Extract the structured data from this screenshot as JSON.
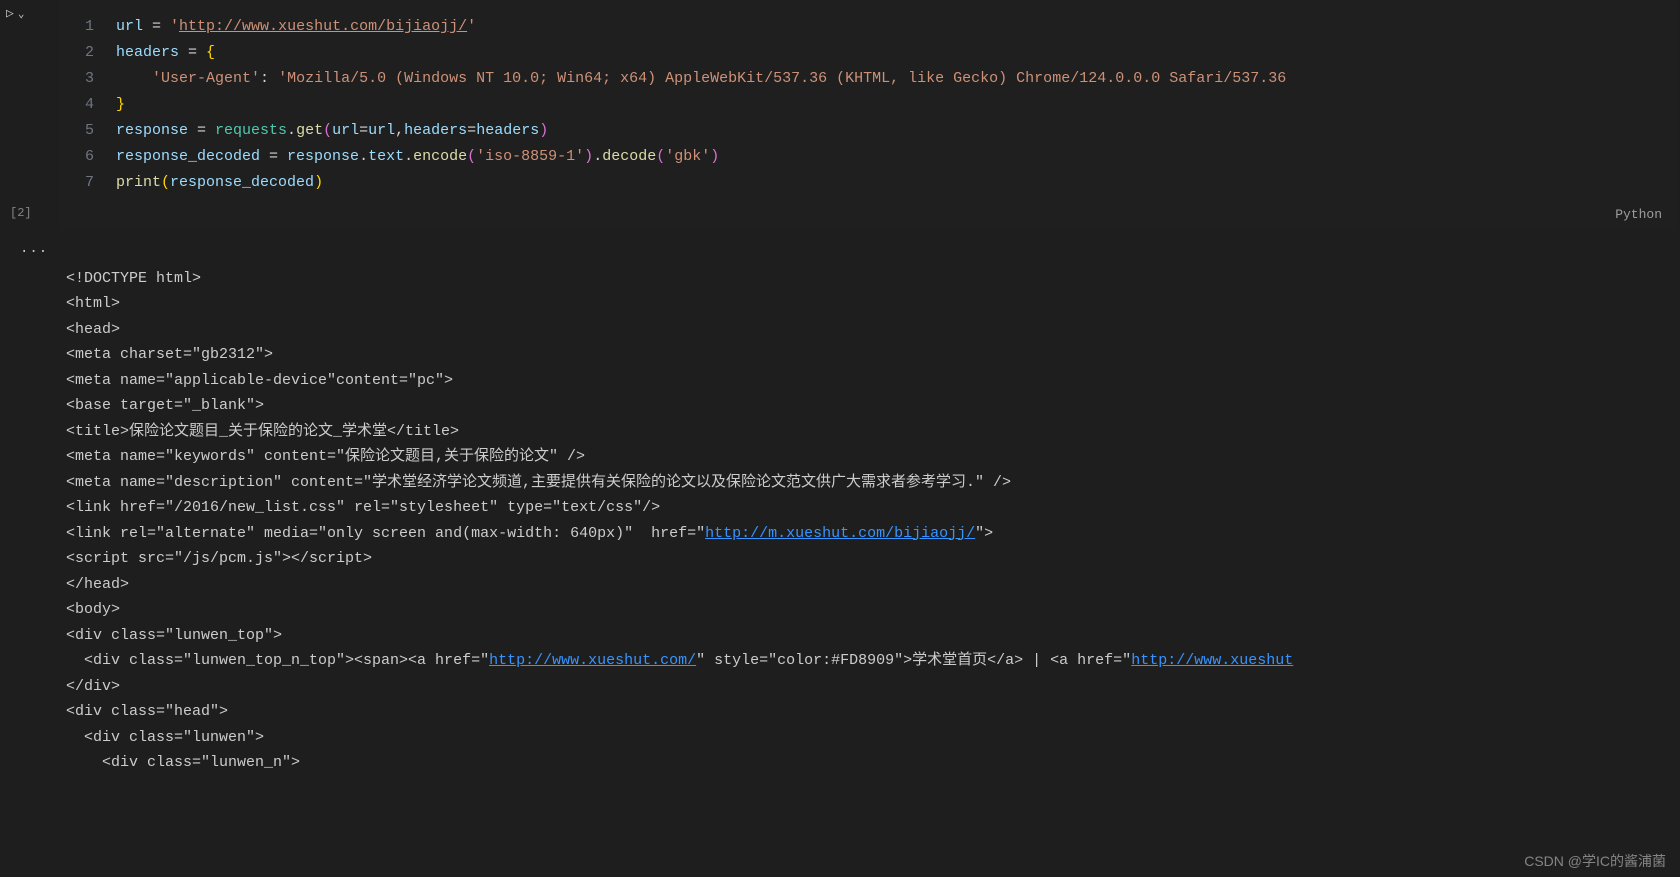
{
  "cell": {
    "execution_count": "[2]",
    "language": "Python",
    "lines": {
      "l1": {
        "num": "1",
        "var": "url",
        "eq": " = ",
        "q1": "'",
        "url": "http://www.xueshut.com/bijiaojj/",
        "q2": "'"
      },
      "l2": {
        "num": "2",
        "var": "headers",
        "eq": " = ",
        "brace": "{"
      },
      "l3": {
        "num": "3",
        "indent": "    ",
        "key": "'User-Agent'",
        "colon": ": ",
        "val": "'Mozilla/5.0 (Windows NT 10.0; Win64; x64) AppleWebKit/537.36 (KHTML, like Gecko) Chrome/124.0.0.0 Safari/537.36"
      },
      "l4": {
        "num": "4",
        "brace": "}"
      },
      "l5": {
        "num": "5",
        "var": "response",
        "eq": " = ",
        "mod": "requests",
        "dot": ".",
        "fn": "get",
        "lp": "(",
        "a1": "url",
        "eq2": "=",
        "a2": "url",
        "comma": ",",
        "a3": "headers",
        "eq3": "=",
        "a4": "headers",
        "rp": ")"
      },
      "l6": {
        "num": "6",
        "var": "response_decoded",
        "eq": " = ",
        "a1": "response",
        "d1": ".",
        "a2": "text",
        "d2": ".",
        "fn1": "encode",
        "lp1": "(",
        "s1": "'iso-8859-1'",
        "rp1": ")",
        "d3": ".",
        "fn2": "decode",
        "lp2": "(",
        "s2": "'gbk'",
        "rp2": ")"
      },
      "l7": {
        "num": "7",
        "fn": "print",
        "lp": "(",
        "arg": "response_decoded",
        "rp": ")"
      }
    }
  },
  "output": {
    "l1": "<!DOCTYPE html>",
    "l2": "<html>",
    "l3": "<head>",
    "l4": "<meta charset=\"gb2312\">",
    "l5": "<meta name=\"applicable-device\"content=\"pc\">",
    "l6": "<base target=\"_blank\">",
    "l7": "<title>保险论文题目_关于保险的论文_学术堂</title>",
    "l8": "<meta name=\"keywords\" content=\"保险论文题目,关于保险的论文\" />",
    "l9": "<meta name=\"description\" content=\"学术堂经济学论文频道,主要提供有关保险的论文以及保险论文范文供广大需求者参考学习.\" />",
    "l10": "<link href=\"/2016/new_list.css\" rel=\"stylesheet\" type=\"text/css\"/>",
    "l11a": "<link rel=\"alternate\" media=\"only screen and(max-width: 640px)\"  href=\"",
    "l11link": "http://m.xueshut.com/bijiaojj/",
    "l11b": "\">",
    "l12": "<script src=\"/js/pcm.js\"></script>",
    "l13": "</head>",
    "l14": "<body>",
    "l15": "<div class=\"lunwen_top\">",
    "l16a": "  <div class=\"lunwen_top_n_top\"><span><a href=\"",
    "l16link": "http://www.xueshut.com/",
    "l16b": "\" style=\"color:#FD8909\">学术堂首页</a> | <a href=\"",
    "l16link2": "http://www.xueshut",
    "l17": "</div>",
    "l18": "<div class=\"head\">",
    "l19": "  <div class=\"lunwen\">",
    "l20": "    <div class=\"lunwen_n\">"
  },
  "watermark": "CSDN @学IC的酱浦菌"
}
